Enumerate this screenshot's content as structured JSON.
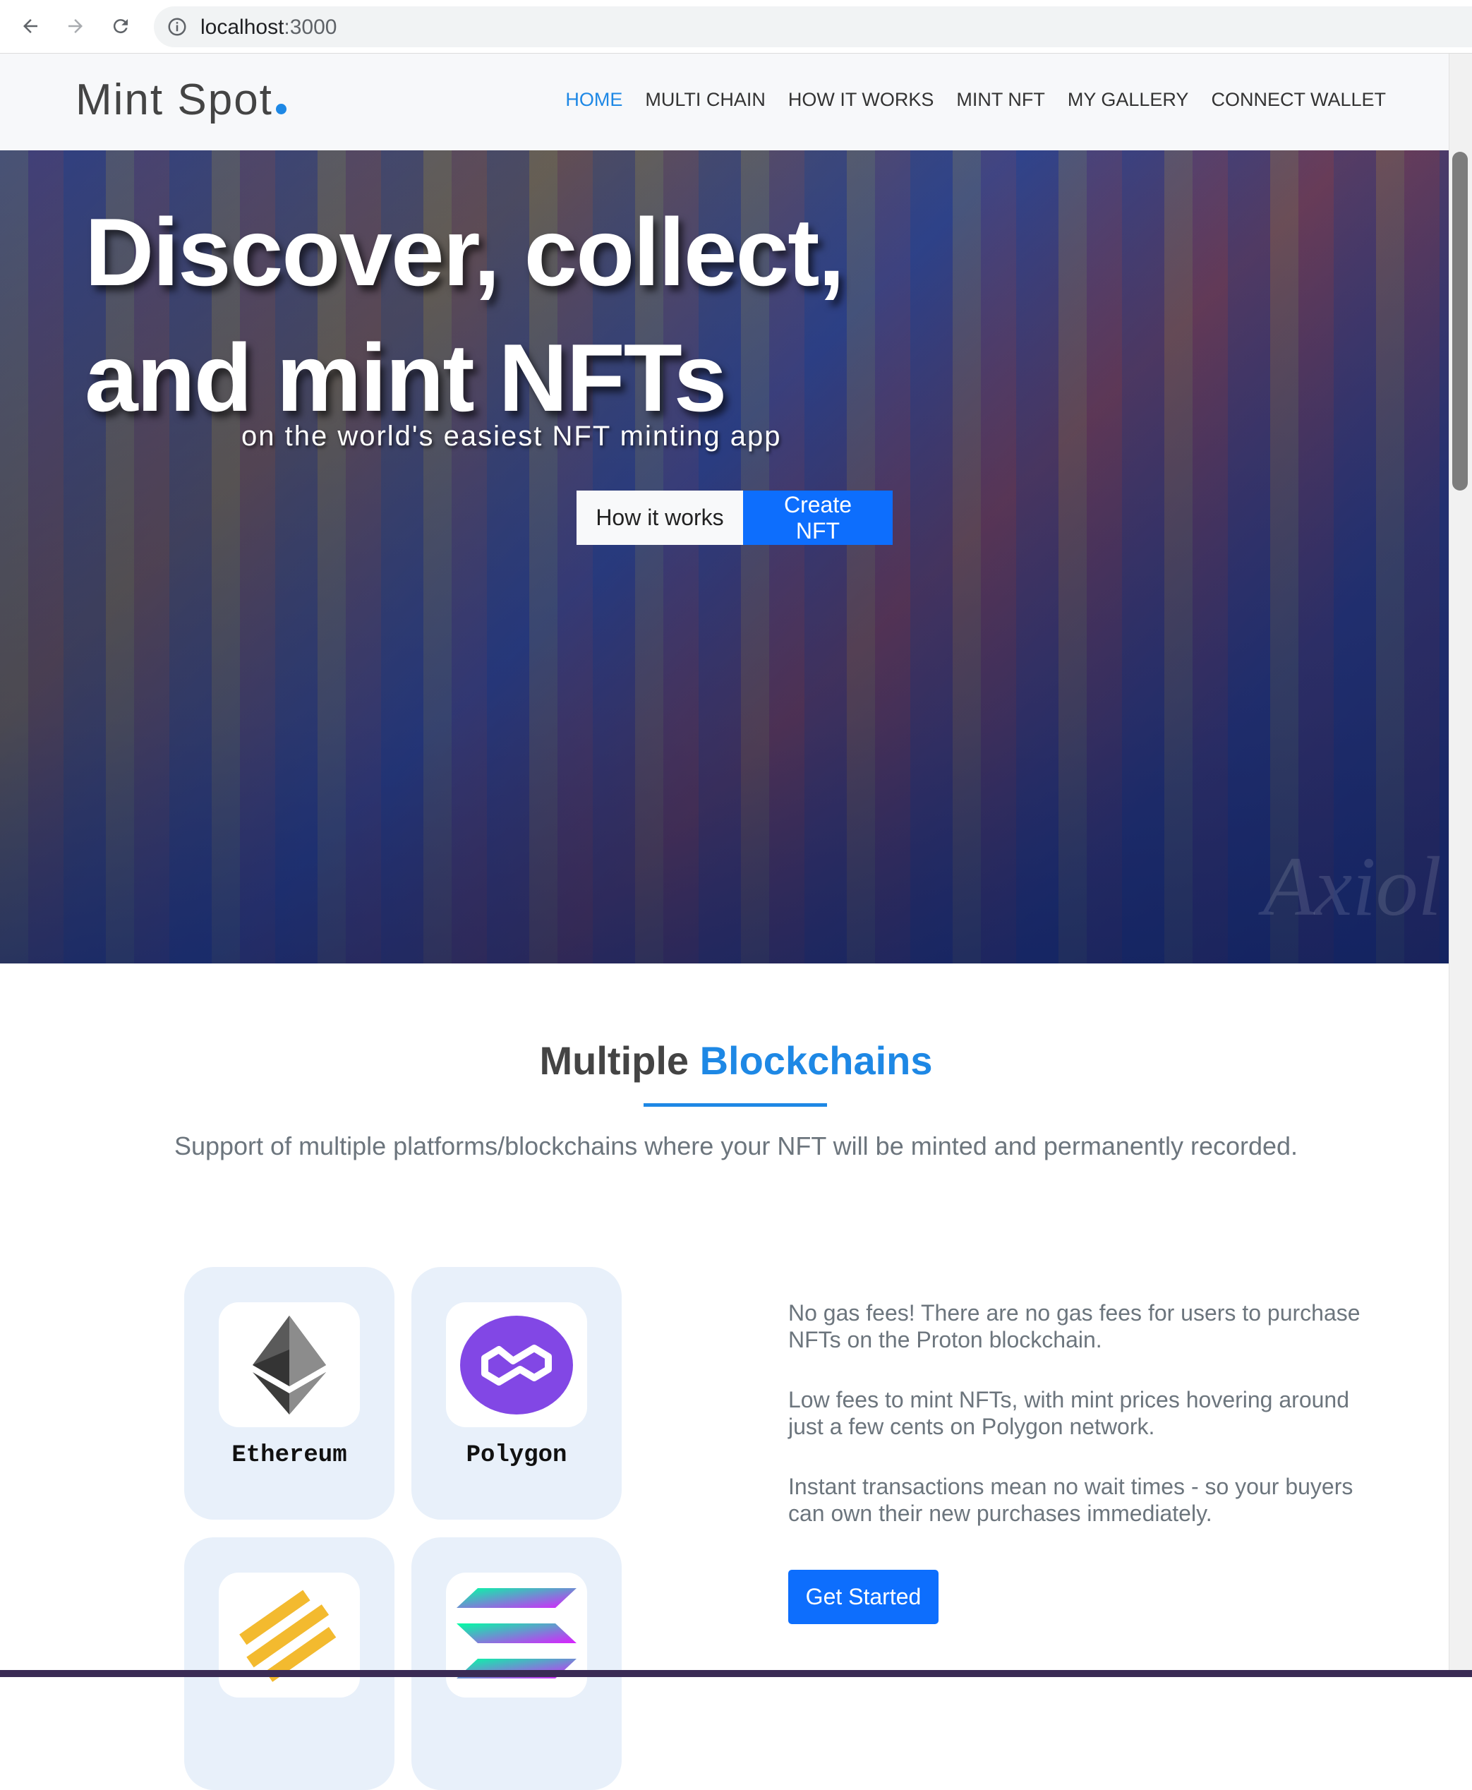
{
  "browser": {
    "url_host": "localhost",
    "url_port": ":3000",
    "icons": [
      "back-arrow-icon",
      "forward-arrow-icon",
      "reload-icon",
      "info-icon"
    ]
  },
  "header": {
    "logo": "Mint Spot",
    "nav": [
      {
        "label": "HOME",
        "active": true
      },
      {
        "label": "MULTI CHAIN",
        "active": false
      },
      {
        "label": "HOW IT WORKS",
        "active": false
      },
      {
        "label": "MINT NFT",
        "active": false
      },
      {
        "label": "MY GALLERY",
        "active": false
      },
      {
        "label": "CONNECT WALLET",
        "active": false
      }
    ]
  },
  "hero": {
    "title": "Discover, collect, and mint NFTs",
    "subtitle": "on the world's easiest NFT minting app",
    "btn_how": "How it works",
    "btn_create": "Create NFT",
    "watermark": "Axiol"
  },
  "blockchains": {
    "title_main": "Multiple ",
    "title_accent": "Blockchains",
    "description": "Support of multiple platforms/blockchains where your NFT will be minted and permanently recorded.",
    "chains": [
      {
        "name": "Ethereum",
        "icon": "ethereum-icon"
      },
      {
        "name": "Polygon",
        "icon": "polygon-icon"
      },
      {
        "name": "",
        "icon": "binance-icon"
      },
      {
        "name": "",
        "icon": "solana-icon"
      }
    ],
    "features": [
      "No gas fees! There are no gas fees for users to purchase NFTs on the Proton blockchain.",
      "Low fees to mint NFTs, with mint prices hovering around just a few cents on Polygon network.",
      "Instant transactions mean no wait times - so your buyers can own their new purchases immediately."
    ],
    "cta": "Get Started"
  },
  "colors": {
    "accent": "#1e88e5",
    "primary_button": "#0d6efd",
    "card_bg": "#e8f0fa"
  }
}
